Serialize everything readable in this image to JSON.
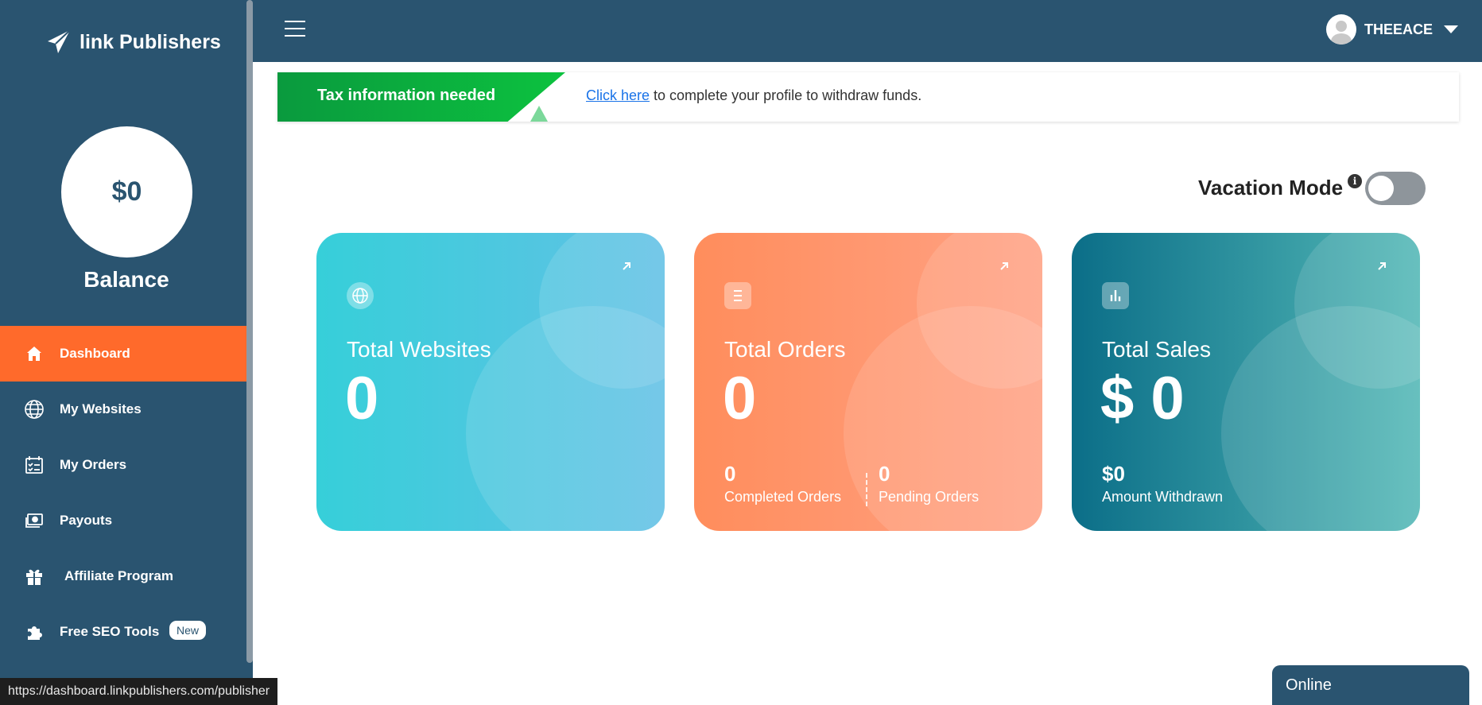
{
  "app": {
    "logo_text": "link Publishers",
    "balance_amount": "$0",
    "balance_label": "Balance"
  },
  "sidebar": {
    "items": [
      {
        "label": "Dashboard",
        "icon": "home-icon",
        "active": true
      },
      {
        "label": "My Websites",
        "icon": "globe-icon"
      },
      {
        "label": "My Orders",
        "icon": "orders-icon"
      },
      {
        "label": "Payouts",
        "icon": "payout-icon"
      },
      {
        "label": "Affiliate Program",
        "icon": "gift-icon"
      },
      {
        "label": "Free SEO Tools",
        "icon": "puzzle-icon",
        "badge": "New"
      }
    ]
  },
  "header": {
    "username": "THEEACE"
  },
  "banner": {
    "title": "Tax information needed",
    "link_text": "Click here",
    "message": " to complete your profile to withdraw funds."
  },
  "vacation": {
    "label": "Vacation Mode",
    "info": "i",
    "enabled": false
  },
  "cards": {
    "websites": {
      "title": "Total Websites",
      "value": "0"
    },
    "orders": {
      "title": "Total Orders",
      "value": "0",
      "completed_value": "0",
      "completed_label": "Completed Orders",
      "pending_value": "0",
      "pending_label": "Pending Orders"
    },
    "sales": {
      "title": "Total Sales",
      "value": "$ 0",
      "withdrawn_value": "$0",
      "withdrawn_label": "Amount Withdrawn"
    }
  },
  "status_bar": {
    "url": "https://dashboard.linkpublishers.com/publisher"
  },
  "chat": {
    "status": "Online"
  },
  "colors": {
    "sidebar": "#2a5470",
    "active_nav": "#ff6a2b",
    "websites_card": "#36cfd9",
    "orders_card": "#ff8d5c",
    "sales_card": "#0b6e88"
  }
}
